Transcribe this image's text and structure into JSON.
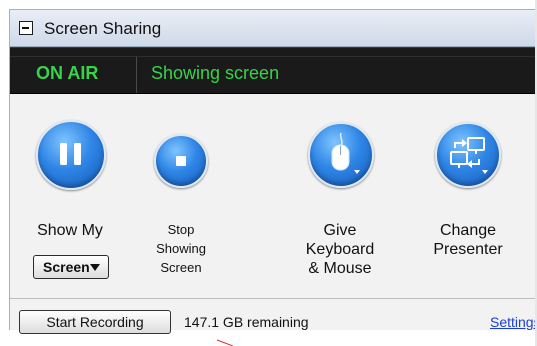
{
  "panel": {
    "title": "Screen Sharing",
    "collapse_icon": "minus-box-icon"
  },
  "status": {
    "badge": "ON AIR",
    "text": "Showing screen",
    "badge_color": "#37d34a"
  },
  "tools": {
    "show_my": {
      "label": "Show My",
      "dropdown_value": "Screen",
      "icon": "pause-icon"
    },
    "stop": {
      "line1": "Stop",
      "line2": "Showing",
      "line3": "Screen",
      "icon": "stop-icon"
    },
    "keyboard": {
      "line1": "Give",
      "line2": "Keyboard",
      "line3": "& Mouse",
      "icon": "mouse-icon"
    },
    "presenter": {
      "line1": "Change",
      "line2": "Presenter",
      "icon": "change-presenter-icon"
    }
  },
  "footer": {
    "record_button": "Start Recording",
    "remaining": "147.1 GB remaining",
    "settings_link": "Settings"
  },
  "colors": {
    "accent_blue": "#2f86e6",
    "link": "#1a3fd1",
    "onair_bg": "#1a1a1a"
  }
}
